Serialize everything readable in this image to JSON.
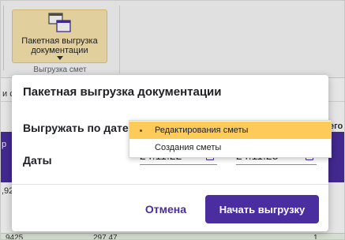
{
  "ribbon": {
    "export_button_label": "Пакетная выгрузка документации",
    "group_label": "Выгрузка смет"
  },
  "background": {
    "col_fragment_left": "и с",
    "row_fragment_left": "р",
    "value_fragment_left": ",92",
    "col_fragment_right": "его",
    "bottom_row_left": "9425",
    "bottom_row_mid": "297,47",
    "bottom_row_right": "1"
  },
  "dialog": {
    "title": "Пакетная выгрузка документации",
    "export_by_label": "Выгружать по дате",
    "dates_label": "Даты",
    "date_from": "24.11.22",
    "date_to": "24.11.23",
    "cancel_label": "Отмена",
    "start_label": "Начать выгрузку"
  },
  "dropdown": {
    "options": [
      {
        "label": "Редактирования сметы",
        "selected": true
      },
      {
        "label": "Создания сметы",
        "selected": false
      }
    ]
  },
  "colors": {
    "accent": "#4a2ea0",
    "selected_option": "#fdcb5a",
    "ribbon_button": "#fbe8b0"
  }
}
